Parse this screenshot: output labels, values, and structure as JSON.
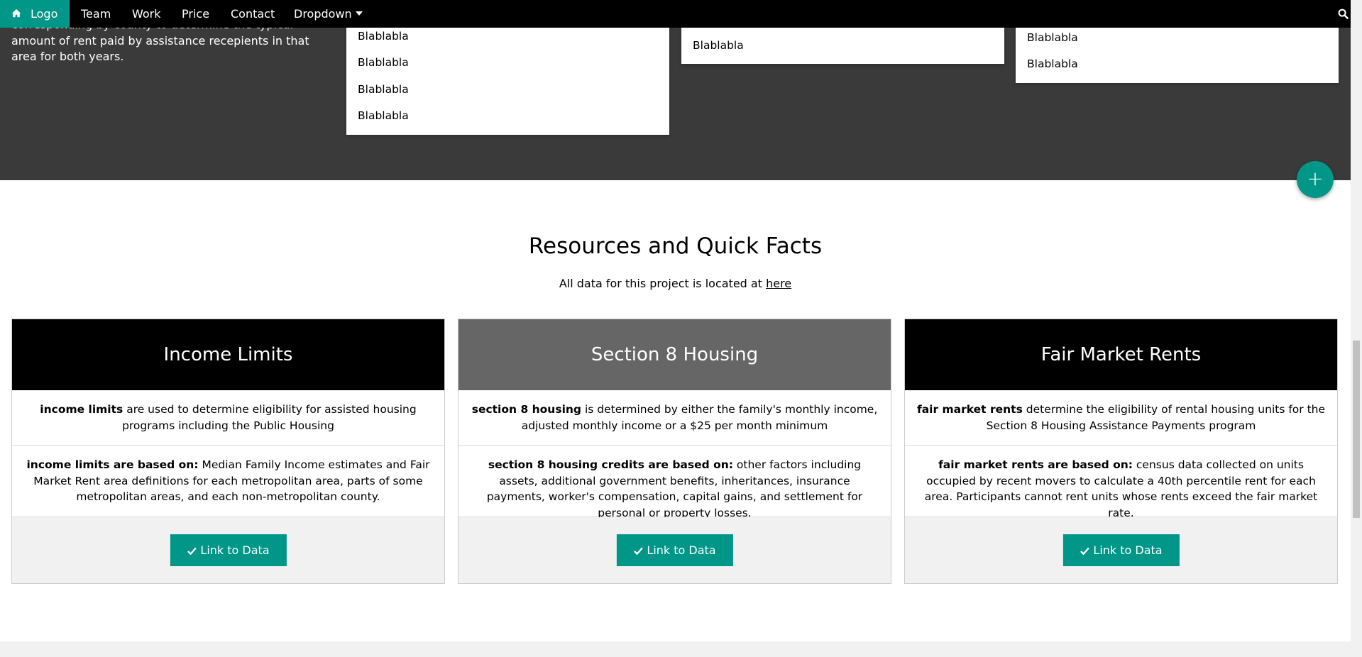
{
  "nav": {
    "logo_label": "Logo",
    "items": [
      "Team",
      "Work",
      "Price",
      "Contact"
    ],
    "dropdown_label": "Dropdown",
    "icons": {
      "home": "home-icon",
      "search": "search-icon",
      "caret": "caret-down-icon"
    }
  },
  "intro": {
    "text": "corresponding by county to determine the typical amount of rent paid by assistance recepients in that area for both years."
  },
  "dropdown_cards": [
    {
      "items": [
        "Blablabla",
        "Blablabla",
        "Blablabla",
        "Blablabla"
      ]
    },
    {
      "items": [
        "Blablabla"
      ]
    },
    {
      "items": [
        "Blablabla",
        "Blablabla"
      ]
    }
  ],
  "fab": {
    "label": "+"
  },
  "resources": {
    "title": "Resources and Quick Facts",
    "subtitle_prefix": "All data for this project is located at ",
    "subtitle_link": "here"
  },
  "panels": [
    {
      "title": "Income Limits",
      "header_color": "#000000",
      "row1_bold": "income limits",
      "row1_text": " are used to determine eligibility for assisted housing programs including the Public Housing",
      "row2_bold": "income limits are based on:",
      "row2_text": " Median Family Income estimates and Fair Market Rent area definitions for each metropolitan area, parts of some metropolitan areas, and each non-metropolitan county.",
      "button": "Link to Data"
    },
    {
      "title": "Section 8 Housing",
      "header_color": "#666666",
      "row1_bold": "section 8 housing",
      "row1_text": " is determined by either the family's monthly income, adjusted monthly income or a $25 per month minimum",
      "row2_bold": "section 8 housing credits are based on:",
      "row2_text": " other factors including assets, additional government benefits, inheritances, insurance payments, worker's compensation, capital gains, and settlement for personal or property losses.",
      "button": "Link to Data"
    },
    {
      "title": "Fair Market Rents",
      "header_color": "#000000",
      "row1_bold": "fair market rents",
      "row1_text": " determine the eligibility of rental housing units for the Section 8 Housing Assistance Payments program",
      "row2_bold": "fair market rents are based on:",
      "row2_text": " census data collected on units occupied by recent movers to calculate a 40th percentile rent for each area. Participants cannot rent units whose rents exceed the fair market rate.",
      "button": "Link to Data"
    }
  ],
  "colors": {
    "accent": "#009688",
    "dark_section": "#3a3a3a",
    "navbar": "#000000"
  }
}
